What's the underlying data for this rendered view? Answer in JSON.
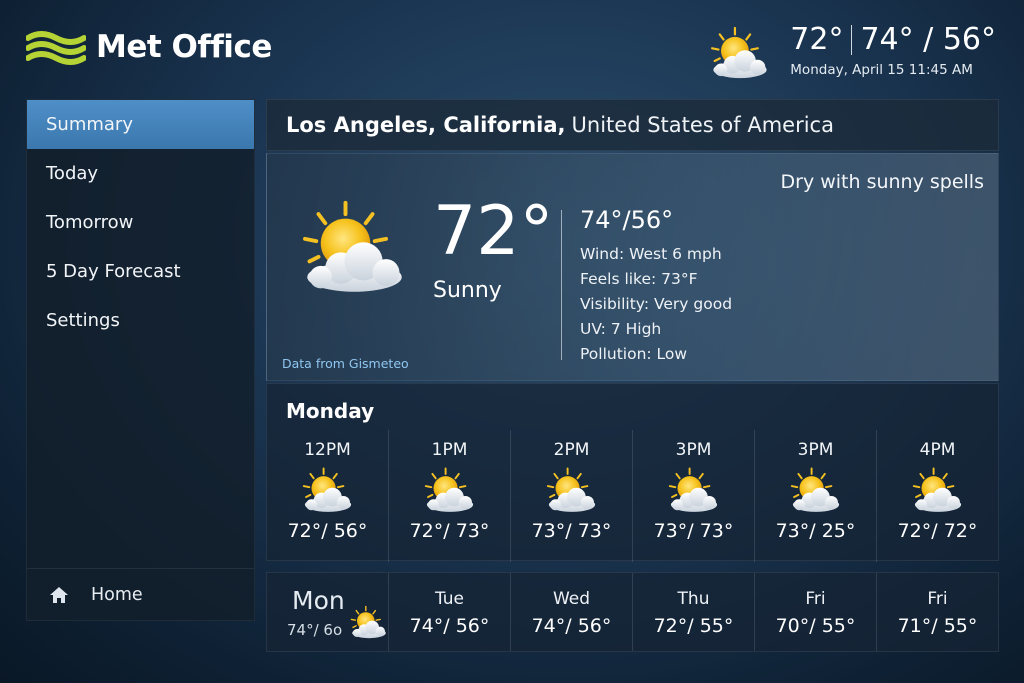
{
  "header": {
    "logo_text": "Met Office",
    "current_temp": "72°",
    "hi_lo": "74° / 56°",
    "datetime": "Monday, April 15 11:45 AM"
  },
  "sidebar": {
    "items": [
      {
        "label": "Summary"
      },
      {
        "label": "Today"
      },
      {
        "label": "Tomorrow"
      },
      {
        "label": "5 Day Forecast"
      },
      {
        "label": "Settings"
      }
    ],
    "active_index": 0,
    "home_label": "Home"
  },
  "location": {
    "city": "Los Angeles, California,",
    "country": "United States of America"
  },
  "current": {
    "temp": "72°",
    "condition": "Sunny",
    "hi_lo": "74°/56°",
    "wind": "Wind: West 6 mph",
    "feels_like": "Feels like: 73°F",
    "visibility": "Visibility: Very good",
    "uv": "UV: 7 High",
    "pollution": "Pollution: Low",
    "summary": "Dry with sunny spells",
    "source": "Data from Gismeteo",
    "icon": "sun-cloud-icon"
  },
  "hourly": {
    "day_label": "Monday",
    "hours": [
      {
        "time": "12PM",
        "temps": "72°/ 56°"
      },
      {
        "time": "1PM",
        "temps": "72°/ 73°"
      },
      {
        "time": "2PM",
        "temps": "73°/ 73°"
      },
      {
        "time": "3PM",
        "temps": "73°/ 73°"
      },
      {
        "time": "3PM",
        "temps": "73°/ 25°"
      },
      {
        "time": "4PM",
        "temps": "72°/ 72°"
      }
    ]
  },
  "daily": {
    "first": {
      "name": "Mon",
      "temps": "74°/ 6o"
    },
    "days": [
      {
        "name": "Tue",
        "temps": "74°/ 56°"
      },
      {
        "name": "Wed",
        "temps": "74°/ 56°"
      },
      {
        "name": "Thu",
        "temps": "72°/ 55°"
      },
      {
        "name": "Fri",
        "temps": "70°/ 55°"
      },
      {
        "name": "Fri",
        "temps": "71°/ 55°"
      }
    ]
  },
  "colors": {
    "accent": "#4a8ac4",
    "logo_green": "#b5d334",
    "link": "#8fc6f0"
  }
}
